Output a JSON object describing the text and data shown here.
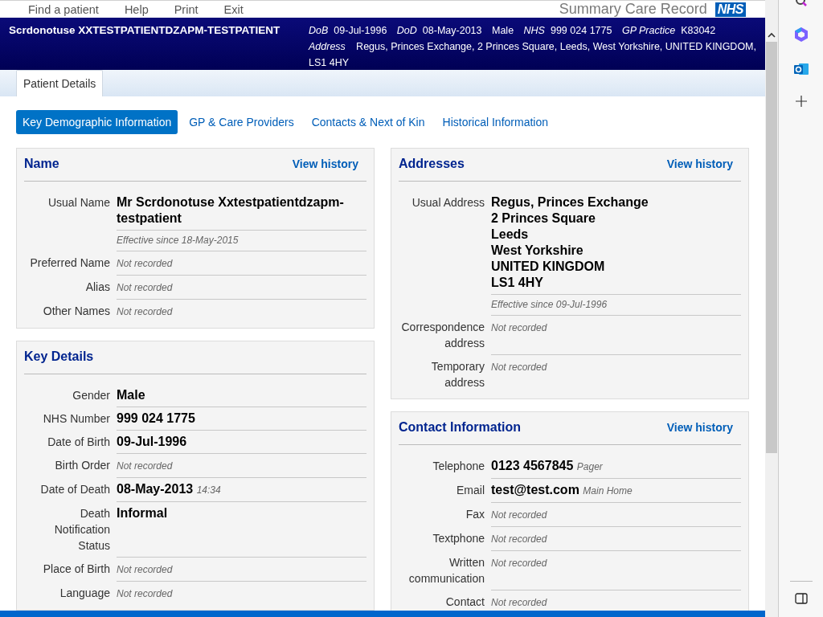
{
  "nav": {
    "links": [
      "Find a patient",
      "Help",
      "Print",
      "Exit"
    ],
    "app_title": "Summary Care Record",
    "logo": "NHS"
  },
  "banner": {
    "patient_name": "Scrdonotuse XXTESTPATIENTDZAPM-TESTPATIENT",
    "details": [
      {
        "label": "DoB",
        "value": "09-Jul-1996"
      },
      {
        "label": "DoD",
        "value": "08-May-2013"
      },
      {
        "value": "Male"
      },
      {
        "label": "NHS",
        "value": "999 024 1775"
      },
      {
        "label": "GP Practice",
        "value": "K83042"
      }
    ],
    "address": {
      "label": "Address",
      "value": "Regus, Princes Exchange, 2 Princes Square, Leeds, West Yorkshire, UNITED KINGDOM, LS1 4HY"
    }
  },
  "tabs": [
    {
      "label": "Patient Details",
      "selected": true
    }
  ],
  "subtabs": [
    {
      "label": "Key Demographic Information",
      "selected": true
    },
    {
      "label": "GP & Care Providers",
      "selected": false
    },
    {
      "label": "Contacts & Next of Kin",
      "selected": false
    },
    {
      "label": "Historical Information",
      "selected": false
    }
  ],
  "left_panels": [
    {
      "title": "Name",
      "action": "View history",
      "rows": [
        {
          "label": "Usual Name",
          "value": "Mr Scrdonotuse Xxtestpatientdzapm-testpatient",
          "effective": "Effective since 18-May-2015"
        },
        {
          "label": "Preferred Name",
          "note": "Not recorded"
        },
        {
          "label": "Alias",
          "note": "Not recorded"
        },
        {
          "label": "Other Names",
          "note": "Not recorded"
        }
      ]
    },
    {
      "title": "Key Details",
      "rows": [
        {
          "label": "Gender",
          "value": "Male"
        },
        {
          "label": "NHS Number",
          "value": "999 024 1775"
        },
        {
          "label": "Date of Birth",
          "value": "09-Jul-1996"
        },
        {
          "label": "Birth Order",
          "note": "Not recorded"
        },
        {
          "label": "Date of Death",
          "value": "08-May-2013",
          "note": "14:34"
        },
        {
          "label": "Death Notification Status",
          "value": "Informal"
        },
        {
          "label": "Place of Birth",
          "note": "Not recorded"
        },
        {
          "label": "Language",
          "note": "Not recorded"
        }
      ]
    }
  ],
  "right_panels": [
    {
      "title": "Addresses",
      "action": "View history",
      "rows": [
        {
          "label": "Usual Address",
          "lines": [
            "Regus, Princes Exchange",
            "2 Princes Square",
            "Leeds",
            "West Yorkshire",
            "UNITED KINGDOM",
            "LS1 4HY"
          ],
          "effective": "Effective since 09-Jul-1996"
        },
        {
          "label": "Correspondence address",
          "note": "Not recorded"
        },
        {
          "label": "Temporary address",
          "note": "Not recorded"
        }
      ]
    },
    {
      "title": "Contact Information",
      "action": "View history",
      "rows": [
        {
          "label": "Telephone",
          "value": "0123 4567845",
          "note": "Pager"
        },
        {
          "label": "Email",
          "value": "test@test.com",
          "note": "Main Home"
        },
        {
          "label": "Fax",
          "note": "Not recorded"
        },
        {
          "label": "Textphone",
          "note": "Not recorded"
        },
        {
          "label": "Written communication",
          "note": "Not recorded"
        },
        {
          "label": "Contact",
          "note": "Not recorded"
        }
      ]
    }
  ]
}
